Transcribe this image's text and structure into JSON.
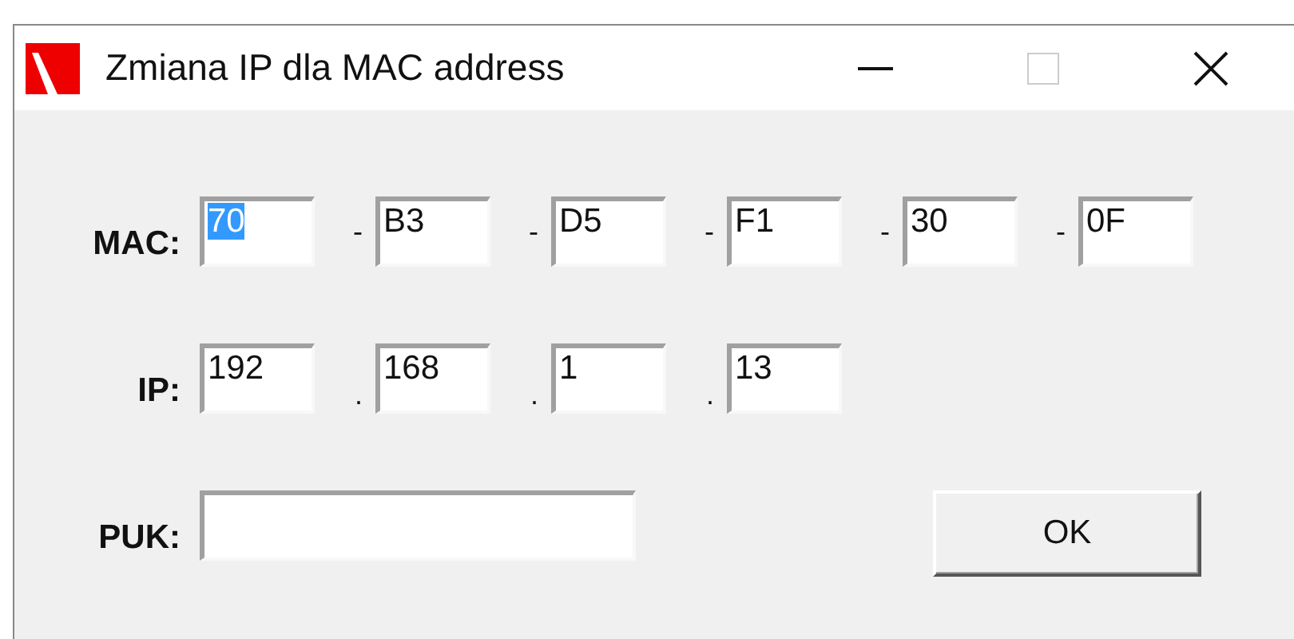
{
  "window": {
    "title": "Zmiana IP dla MAC address"
  },
  "mac": {
    "label": "MAC:",
    "fields": [
      {
        "value": "70",
        "selected": true
      },
      {
        "value": "B3",
        "selected": false
      },
      {
        "value": "D5",
        "selected": false
      },
      {
        "value": "F1",
        "selected": false
      },
      {
        "value": "30",
        "selected": false
      },
      {
        "value": "0F",
        "selected": false
      }
    ],
    "separators": [
      "-",
      "-",
      "-",
      "-",
      "-"
    ]
  },
  "ip": {
    "label": "IP:",
    "fields": [
      {
        "value": "192",
        "selected": false
      },
      {
        "value": "168",
        "selected": false
      },
      {
        "value": "1",
        "selected": false
      },
      {
        "value": "13",
        "selected": false
      }
    ],
    "separators": [
      ".",
      ".",
      "."
    ]
  },
  "puk": {
    "label": "PUK:"
  },
  "buttons": [
    "OK"
  ]
}
